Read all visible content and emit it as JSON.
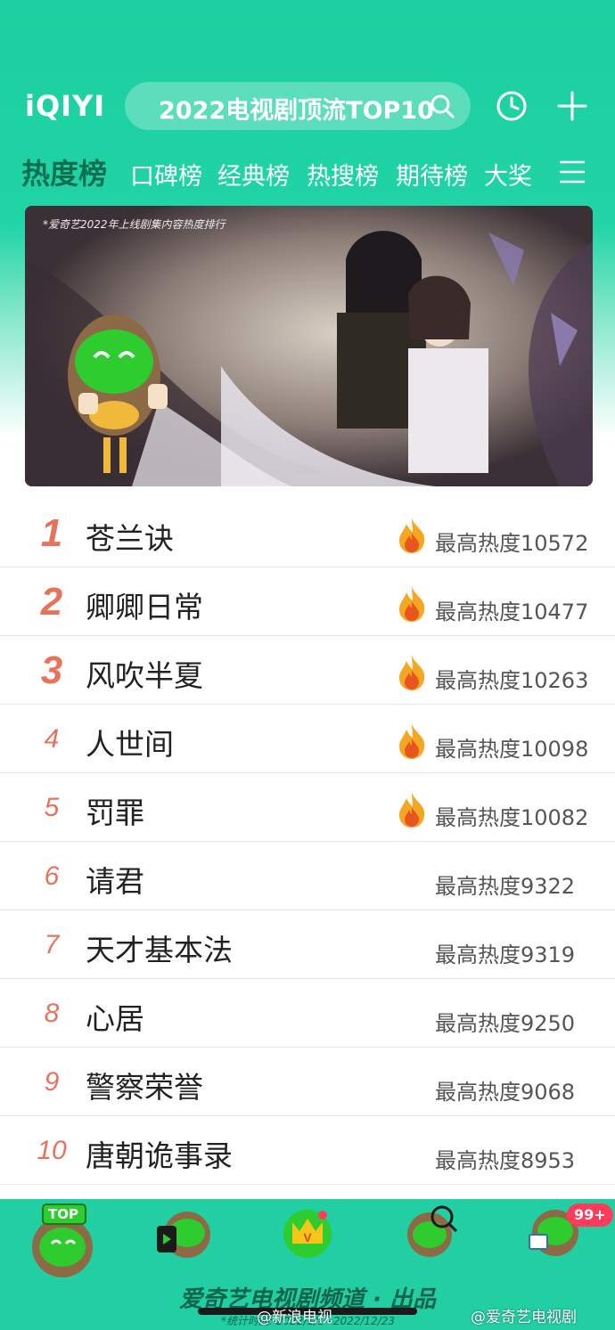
{
  "header": {
    "logo": "iQIYI",
    "search_text": "2022电视剧顶流TOP10"
  },
  "tabs": [
    "热度榜",
    "口碑榜",
    "经典榜",
    "热搜榜",
    "期待榜",
    "大奖"
  ],
  "banner": {
    "note": "*爱奇艺2022年上线剧集内容热度排行"
  },
  "ranking": [
    {
      "rank": "1",
      "title": "苍兰诀",
      "heat": "最高热度10572",
      "hot": true
    },
    {
      "rank": "2",
      "title": "卿卿日常",
      "heat": "最高热度10477",
      "hot": true
    },
    {
      "rank": "3",
      "title": "风吹半夏",
      "heat": "最高热度10263",
      "hot": true
    },
    {
      "rank": "4",
      "title": "人世间",
      "heat": "最高热度10098",
      "hot": true
    },
    {
      "rank": "5",
      "title": "罚罪",
      "heat": "最高热度10082",
      "hot": true
    },
    {
      "rank": "6",
      "title": "请君",
      "heat": "最高热度9322",
      "hot": false
    },
    {
      "rank": "7",
      "title": "天才基本法",
      "heat": "最高热度9319",
      "hot": false
    },
    {
      "rank": "8",
      "title": "心居",
      "heat": "最高热度9250",
      "hot": false
    },
    {
      "rank": "9",
      "title": "警察荣誉",
      "heat": "最高热度9068",
      "hot": false
    },
    {
      "rank": "10",
      "title": "唐朝诡事录",
      "heat": "最高热度8953",
      "hot": false
    }
  ],
  "bottom": {
    "top_badge": "TOP",
    "notify_badge": "99+",
    "footer": "爱奇艺电视剧频道 · 出品",
    "stat_time": "*统计时间: 2022/1/1~2022/12/23",
    "watermark_left": "@新浪电视",
    "watermark_right": "@爱奇艺电视剧"
  },
  "colors": {
    "brand": "#21cfa3",
    "rank": "#e8735c",
    "active_tab": "#0e6e52"
  }
}
